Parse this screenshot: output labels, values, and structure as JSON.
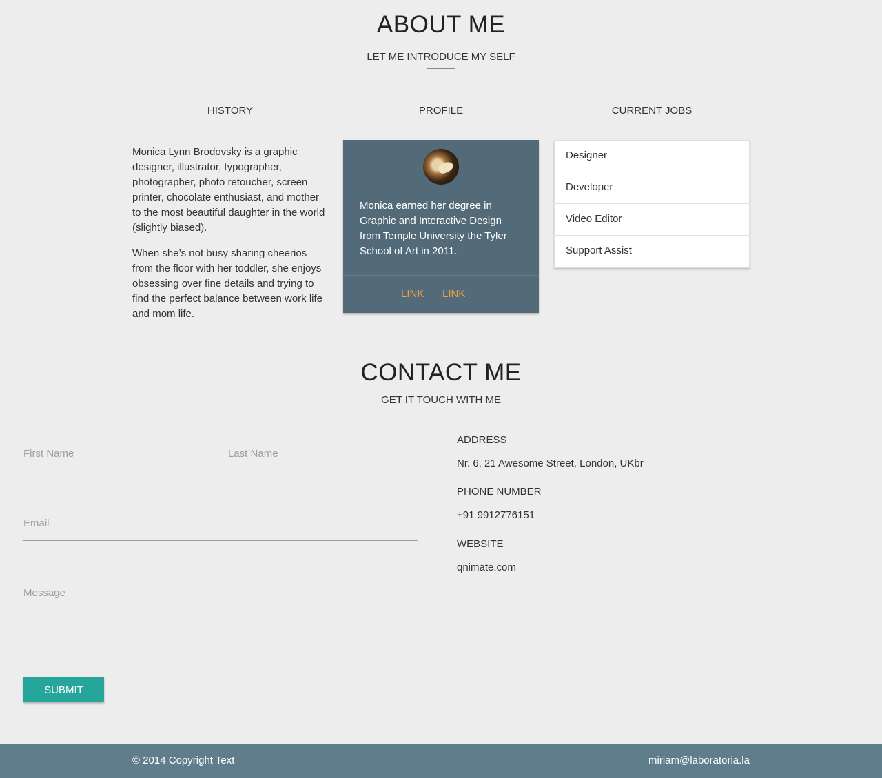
{
  "about": {
    "title": "ABOUT ME",
    "subtitle": "LET ME INTRODUCE MY SELF",
    "columns": {
      "history": "HISTORY",
      "profile": "PROFILE",
      "jobs": "CURRENT JOBS"
    },
    "history_paragraphs": [
      "Monica Lynn Brodovsky is a graphic designer, illustrator, typographer, photographer, photo retoucher, screen printer, chocolate enthusiast, and mother to the most beautiful daughter in the world (slightly biased).",
      "When she’s not busy sharing cheerios from the floor with her toddler, she enjoys obsessing over fine details and trying to find the perfect balance between work life and mom life."
    ],
    "profile_card": {
      "text": "Monica earned her degree in Graphic and Interactive Design from Temple University the Tyler School of Art in 2011.",
      "links": [
        "LINK",
        "LINK"
      ],
      "accent": "#f0a040",
      "background": "#536b78"
    },
    "jobs": [
      "Designer",
      "Developer",
      "Video Editor",
      "Support Assist"
    ]
  },
  "contact": {
    "title": "CONTACT ME",
    "subtitle": "GET IT TOUCH WITH ME",
    "form": {
      "first_name_placeholder": "First Name",
      "last_name_placeholder": "Last Name",
      "email_placeholder": "Email",
      "message_placeholder": "Message",
      "submit_label": "SUBMIT",
      "submit_color": "#26a69a"
    },
    "info": {
      "address_label": "ADDRESS",
      "address_value": "Nr. 6, 21 Awesome Street, London, UKbr",
      "phone_label": "PHONE NUMBER",
      "phone_value": "+91 9912776151",
      "website_label": "WEBSITE",
      "website_value": "qnimate.com"
    }
  },
  "footer": {
    "copyright": "© 2014 Copyright Text",
    "email": "miriam@laboratoria.la",
    "background": "#607d8b"
  },
  "icons": {
    "avatar": "profile-avatar-photo"
  }
}
